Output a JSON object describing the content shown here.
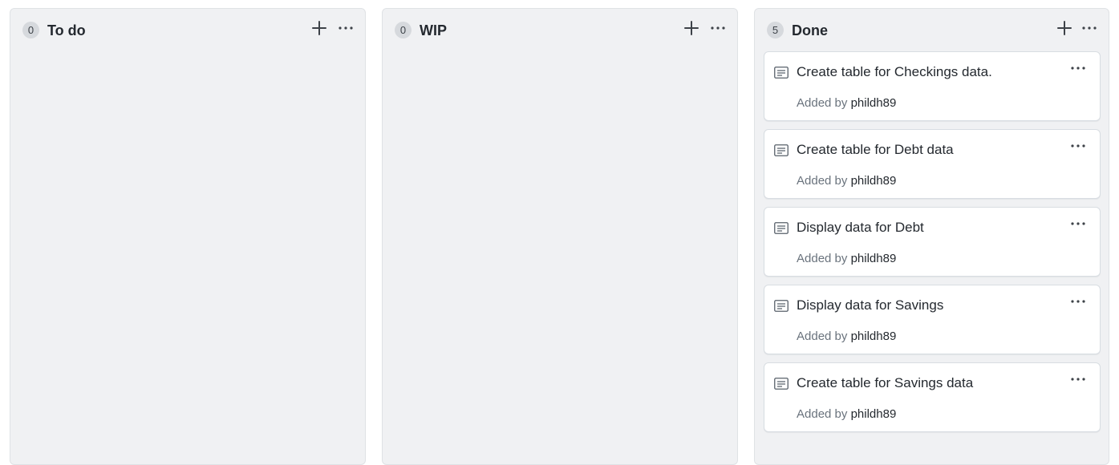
{
  "board": {
    "columns": [
      {
        "count": "0",
        "title": "To do"
      },
      {
        "count": "0",
        "title": "WIP"
      },
      {
        "count": "5",
        "title": "Done"
      }
    ],
    "cards": [
      {
        "title": "Create table for Checkings data.",
        "added_by_label": "Added by",
        "author": "phildh89"
      },
      {
        "title": "Create table for Debt data",
        "added_by_label": "Added by",
        "author": "phildh89"
      },
      {
        "title": "Display data for Debt",
        "added_by_label": "Added by",
        "author": "phildh89"
      },
      {
        "title": "Display data for Savings",
        "added_by_label": "Added by",
        "author": "phildh89"
      },
      {
        "title": "Create table for Savings data",
        "added_by_label": "Added by",
        "author": "phildh89"
      }
    ]
  },
  "icons": {
    "add": "plus-icon",
    "more": "kebab-horizontal-icon",
    "note": "note-icon"
  },
  "colors": {
    "column_bg": "#f0f1f3",
    "card_bg": "#ffffff",
    "text": "#24292f",
    "muted": "#6a737d",
    "count_bg": "#d6d9dd"
  }
}
